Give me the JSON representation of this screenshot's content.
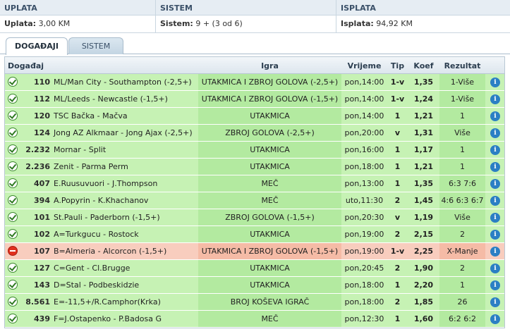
{
  "summary": {
    "uplata": {
      "title": "UPLATA",
      "label": "Uplata:",
      "value": "3,00 KM"
    },
    "sistem": {
      "title": "SISTEM",
      "label": "Sistem:",
      "value": "9 + (3 od 6)"
    },
    "isplata": {
      "title": "ISPLATA",
      "label": "Isplata:",
      "value": "94,92 KM"
    }
  },
  "tabs": [
    {
      "label": "DOGAĐAJI",
      "active": true
    },
    {
      "label": "SISTEM",
      "active": false
    }
  ],
  "table": {
    "headers": {
      "dogadaj": "Događaj",
      "igra": "Igra",
      "vrijeme": "Vrijeme",
      "tip": "Tip",
      "koef": "Koef",
      "rezultat": "Rezultat"
    },
    "rows": [
      {
        "status": "won",
        "code": "110",
        "event": "ML/Man City - Southampton (-2,5+)",
        "igra": "UTAKMICA I ZBROJ GOLOVA (-2,5+)",
        "vrijeme": "pon,14:00",
        "tip": "1-v",
        "koef": "1,35",
        "rezultat": "1-Više"
      },
      {
        "status": "won",
        "code": "112",
        "event": "ML/Leeds - Newcastle (-1,5+)",
        "igra": "UTAKMICA I ZBROJ GOLOVA (-1,5+)",
        "vrijeme": "pon,14:00",
        "tip": "1-v",
        "koef": "1,24",
        "rezultat": "1-Više"
      },
      {
        "status": "won",
        "code": "120",
        "event": "TSC Bačka - Mačva",
        "igra": "UTAKMICA",
        "vrijeme": "pon,14:00",
        "tip": "1",
        "koef": "1,21",
        "rezultat": "1"
      },
      {
        "status": "won",
        "code": "124",
        "event": "Jong AZ Alkmaar - Jong Ajax (-2,5+)",
        "igra": "ZBROJ GOLOVA (-2,5+)",
        "vrijeme": "pon,20:00",
        "tip": "v",
        "koef": "1,31",
        "rezultat": "Više"
      },
      {
        "status": "won",
        "code": "2.232",
        "event": "Mornar - Split",
        "igra": "UTAKMICA",
        "vrijeme": "pon,16:00",
        "tip": "1",
        "koef": "1,17",
        "rezultat": "1"
      },
      {
        "status": "won",
        "code": "2.236",
        "event": "Zenit - Parma Perm",
        "igra": "UTAKMICA",
        "vrijeme": "pon,18:00",
        "tip": "1",
        "koef": "1,21",
        "rezultat": "1"
      },
      {
        "status": "won",
        "code": "407",
        "event": "E.Ruusuvuori - J.Thompson",
        "igra": "MEČ",
        "vrijeme": "pon,13:00",
        "tip": "1",
        "koef": "1,35",
        "rezultat": "6:3 7:6"
      },
      {
        "status": "won",
        "code": "394",
        "event": "A.Popyrin - K.Khachanov",
        "igra": "MEČ",
        "vrijeme": "uto,11:30",
        "tip": "2",
        "koef": "1,45",
        "rezultat": "4:6 6:3 6:7"
      },
      {
        "status": "won",
        "code": "101",
        "event": "St.Pauli - Paderborn (-1,5+)",
        "igra": "ZBROJ GOLOVA (-1,5+)",
        "vrijeme": "pon,20:30",
        "tip": "v",
        "koef": "1,19",
        "rezultat": "Više"
      },
      {
        "status": "won",
        "code": "102",
        "event": "A=Turkgucu - Rostock",
        "igra": "UTAKMICA",
        "vrijeme": "pon,19:00",
        "tip": "2",
        "koef": "2,15",
        "rezultat": "2"
      },
      {
        "status": "lost",
        "code": "107",
        "event": "B=Almeria - Alcorcon (-1,5+)",
        "igra": "UTAKMICA I ZBROJ GOLOVA (-1,5+)",
        "vrijeme": "pon,19:00",
        "tip": "1-v",
        "koef": "2,25",
        "rezultat": "X-Manje"
      },
      {
        "status": "won",
        "code": "127",
        "event": "C=Gent - Cl.Brugge",
        "igra": "UTAKMICA",
        "vrijeme": "pon,20:45",
        "tip": "2",
        "koef": "1,90",
        "rezultat": "2"
      },
      {
        "status": "won",
        "code": "143",
        "event": "D=Stal - Podbeskidzie",
        "igra": "UTAKMICA",
        "vrijeme": "pon,18:00",
        "tip": "1",
        "koef": "2,20",
        "rezultat": "1"
      },
      {
        "status": "won",
        "code": "8.561",
        "event": "E=-11,5+/R.Camphor(Krka)",
        "igra": "BROJ KOŠEVA IGRAČ",
        "vrijeme": "pon,18:00",
        "tip": "2",
        "koef": "1,85",
        "rezultat": "26"
      },
      {
        "status": "won",
        "code": "439",
        "event": "F=J.Ostapenko - P.Badosa G",
        "igra": "MEČ",
        "vrijeme": "pon,12:30",
        "tip": "1",
        "koef": "1,60",
        "rezultat": "6:2 6:2"
      }
    ]
  },
  "icons": {
    "won": "check-circle-icon",
    "lost": "minus-circle-icon",
    "info": "info-icon"
  },
  "colors": {
    "won_row": "#c6f2b4",
    "lost_row": "#f8cdbe",
    "info": "#2b7fc4"
  }
}
